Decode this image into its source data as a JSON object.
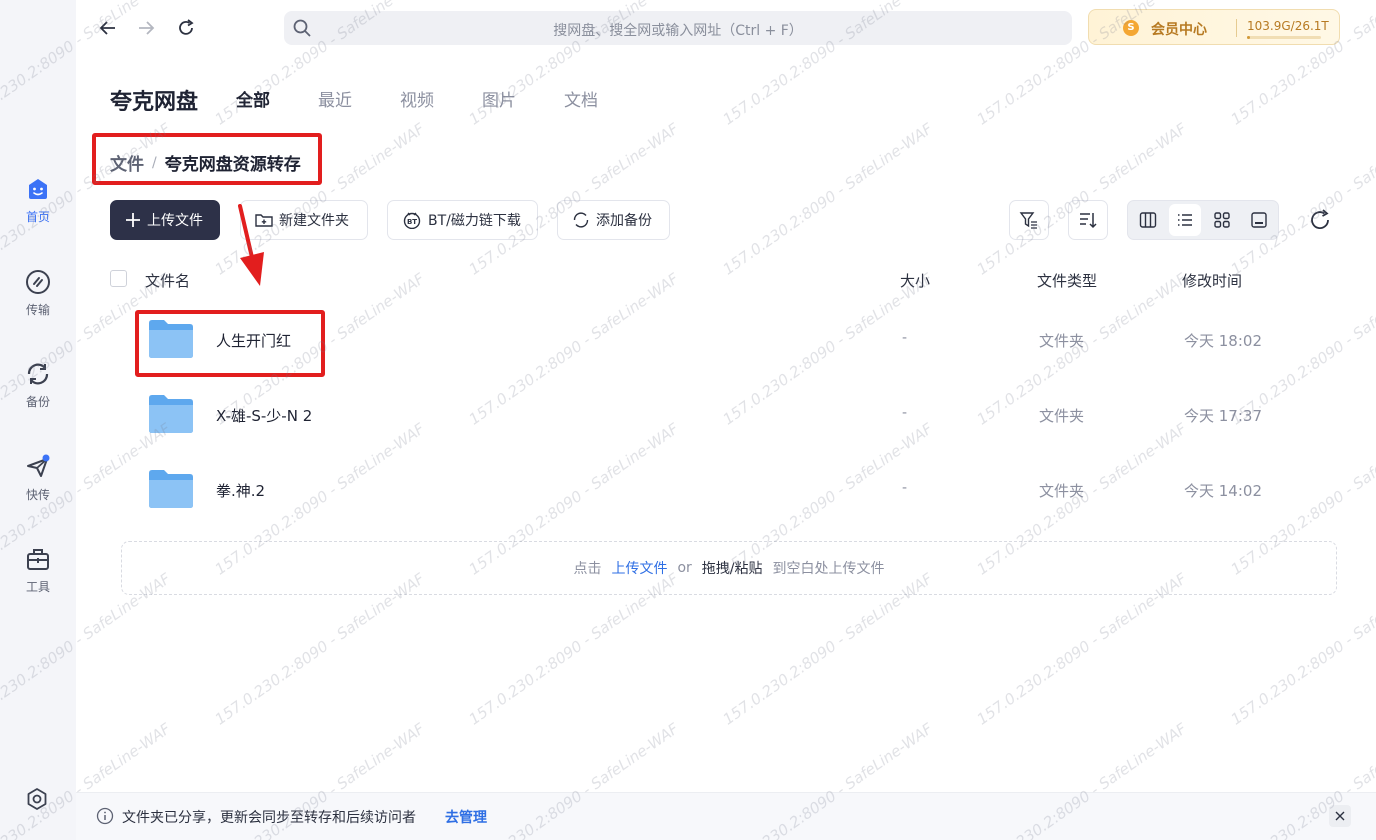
{
  "topbar": {
    "search_placeholder": "搜网盘、搜全网或输入网址（Ctrl + F）",
    "vip_label": "会员中心",
    "vip_coin": "S",
    "storage_text": "103.9G/26.1T",
    "storage_used_fraction": 0.004
  },
  "rail": {
    "items": [
      {
        "label": "首页",
        "icon": "home-face-icon",
        "active": true
      },
      {
        "label": "传输",
        "icon": "transfer-icon"
      },
      {
        "label": "备份",
        "icon": "backup-icon"
      },
      {
        "label": "快传",
        "icon": "send-plane-icon"
      },
      {
        "label": "工具",
        "icon": "toolbox-icon"
      }
    ],
    "settings_icon": "settings-icon"
  },
  "header": {
    "brand": "夸克网盘",
    "tabs": [
      "全部",
      "最近",
      "视频",
      "图片",
      "文档"
    ]
  },
  "breadcrumb": {
    "root": "文件",
    "separator": "/",
    "current": "夸克网盘资源转存"
  },
  "toolbar": {
    "upload": "上传文件",
    "new_folder": "新建文件夹",
    "bt_download": "BT/磁力链下载",
    "add_backup": "添加备份"
  },
  "table": {
    "headers": {
      "name": "文件名",
      "size": "大小",
      "type": "文件类型",
      "time": "修改时间"
    },
    "rows": [
      {
        "name": "人生开门红",
        "size": "-",
        "type": "文件夹",
        "time": "今天 18:02"
      },
      {
        "name": "X-雄-S-少-N 2",
        "size": "-",
        "type": "文件夹",
        "time": "今天 17:37"
      },
      {
        "name": "拳.神.2",
        "size": "-",
        "type": "文件夹",
        "time": "今天 14:02"
      }
    ]
  },
  "dropzone": {
    "prefix": "点击",
    "link": "上传文件",
    "or": "or",
    "drag": "拖拽/粘贴",
    "suffix": "到空白处上传文件"
  },
  "notice": {
    "message": "文件夹已分享，更新会同步至转存和后续访问者",
    "action": "去管理"
  },
  "watermark": "157.0.230.2:8090 - SafeLine-WAF",
  "colors": {
    "accent": "#3b72f6",
    "primary_button": "#2d3148",
    "highlight_red": "#e21e1e",
    "link": "#2f6fe4",
    "folder": "#64aef0"
  }
}
